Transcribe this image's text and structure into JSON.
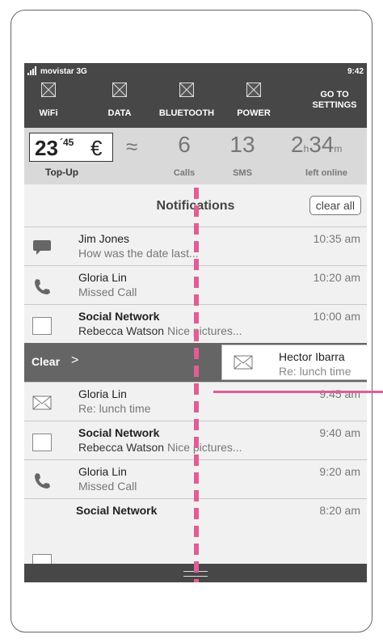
{
  "status": {
    "carrier": "movistar 3G",
    "time": "9:42"
  },
  "quick_settings": {
    "wifi": "WiFi",
    "data": "DATA",
    "bluetooth": "BLUETOOTH",
    "power": "POWER",
    "goto_line1": "GO TO",
    "goto_line2": "SETTINGS"
  },
  "balance": {
    "amount": "23",
    "cents": "´45",
    "currency": "€",
    "approx": "≈",
    "topup_label": "Top-Up",
    "calls": "6",
    "calls_label": "Calls",
    "sms": "13",
    "sms_label": "SMS",
    "online_hours": "2",
    "hours_unit": "h",
    "online_minutes": "34",
    "minutes_unit": "m",
    "online_label": "left online"
  },
  "notifications": {
    "title": "Notifications",
    "clear_all": "clear all",
    "items": [
      {
        "icon": "chat-bubble-icon",
        "title": "Jim Jones",
        "detail": "How was the date last...",
        "time": "10:35 am"
      },
      {
        "icon": "phone-icon",
        "title": "Gloria Lin",
        "detail": "Missed Call",
        "time": "10:20 am"
      },
      {
        "icon": "checkbox",
        "title": "Social Network",
        "detail_strong": "Rebecca Watson",
        "detail": "Nice pictures...",
        "time": "10:00 am"
      },
      {
        "icon": "envelope-icon",
        "title": "Gloria Lin",
        "detail": "Re: lunch time",
        "time": "9:45 am"
      },
      {
        "icon": "checkbox",
        "title": "Social Network",
        "detail_strong": "Rebecca Watson",
        "detail": "Nice pictures...",
        "time": "9:40 am"
      },
      {
        "icon": "phone-icon",
        "title": "Gloria Lin",
        "detail": "Missed Call",
        "time": "9:20 am"
      },
      {
        "icon": "checkbox",
        "title": "Social Network",
        "detail": "",
        "time": "8:20 am"
      }
    ],
    "swiped": {
      "action": "Clear",
      "chevron": ">",
      "name": "Hector Ibarra",
      "detail": "Re: lunch time"
    }
  },
  "colors": {
    "bar": "#474747",
    "annotation": "#e05d97",
    "panel": "#f1f1f1"
  }
}
